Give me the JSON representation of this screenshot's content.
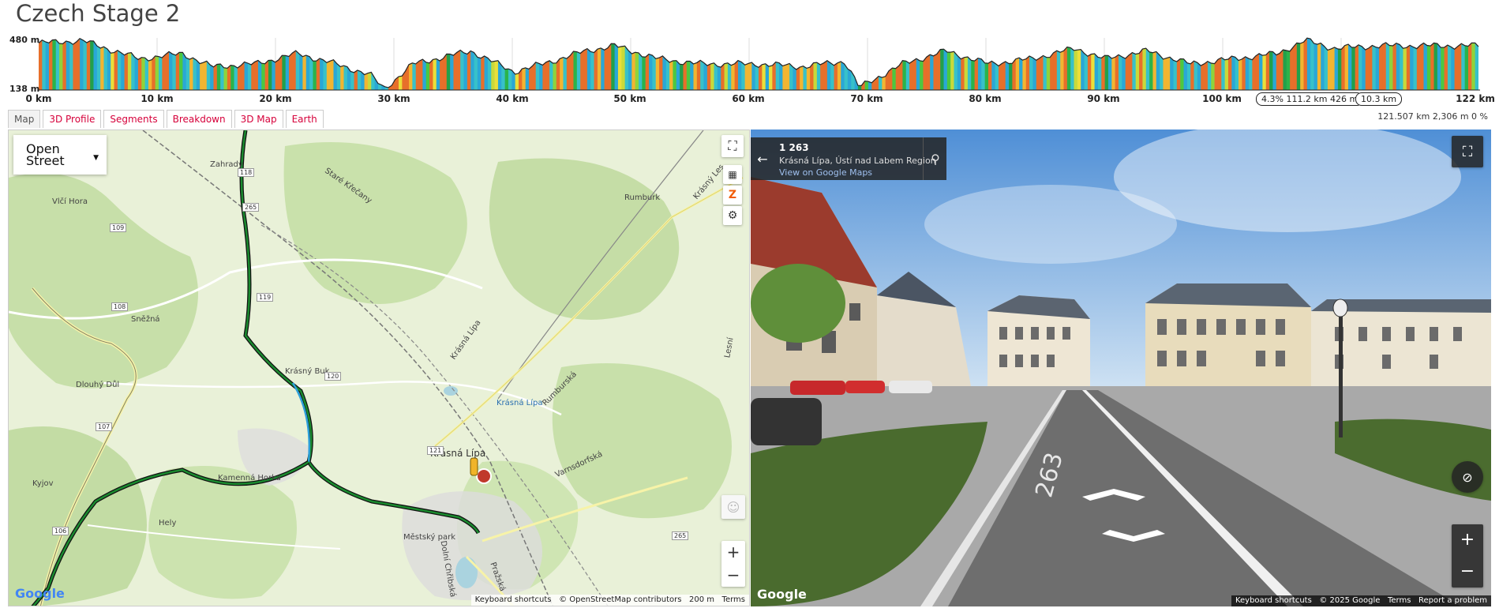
{
  "page": {
    "title": "Czech Stage 2"
  },
  "profile": {
    "y_labels": [
      "480 m",
      "138 m"
    ],
    "x_labels": [
      "0 km",
      "10 km",
      "20 km",
      "30 km",
      "40 km",
      "50 km",
      "60 km",
      "70 km",
      "80 km",
      "90 km",
      "100 km",
      "122 km"
    ],
    "marker_pill": "4.3% 111.2 km 426 m",
    "distance_pill": "10.3 km"
  },
  "tabs": [
    {
      "label": "Map",
      "active": true
    },
    {
      "label": "3D Profile"
    },
    {
      "label": "Segments"
    },
    {
      "label": "Breakdown"
    },
    {
      "label": "3D Map"
    },
    {
      "label": "Earth"
    }
  ],
  "stats": "121.507 km 2,306 m 0 %",
  "map": {
    "layer_select": "Open Street",
    "town_labels": [
      "Vlčí Hora",
      "Zahrady",
      "Sněžná",
      "Dlouhý Důl",
      "Krásný Buk",
      "Krásná Lípa",
      "Krásná Lípa",
      "Kamenná Horka",
      "Kyjov",
      "Hely",
      "Městský park",
      "Staré Křečany",
      "Rumburk",
      "Krásný Les",
      "Varnsdorfská",
      "Rumburská",
      "Pražská",
      "Dolní Chřibská",
      "Lesní",
      "Krásná Lípa"
    ],
    "road_numbers": [
      "118",
      "265",
      "109",
      "108",
      "119",
      "120",
      "107",
      "121",
      "106",
      "265"
    ],
    "controls": {
      "zoom_in": "+",
      "zoom_out": "−"
    },
    "google_logo": "Google",
    "attribution": [
      "Keyboard shortcuts",
      "© OpenStreetMap contributors",
      "200 m",
      "Terms"
    ]
  },
  "streetview": {
    "road_number": "1 263",
    "location": "Krásná Lípa, Ústí nad Labem Region",
    "link": "View on Google Maps",
    "road_marking": "263",
    "google_logo": "Google",
    "attribution": [
      "Keyboard shortcuts",
      "© 2025 Google",
      "Terms",
      "Report a problem"
    ],
    "controls": {
      "zoom_in": "+",
      "zoom_out": "−"
    }
  },
  "colors": {
    "accent": "#d6003a",
    "route_green": "#1a8a2e",
    "route_blue": "#2b9fd9"
  }
}
